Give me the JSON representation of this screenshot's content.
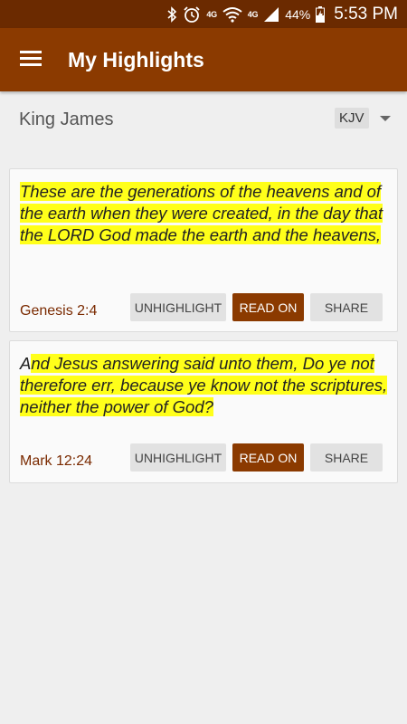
{
  "status_bar": {
    "battery_percent": "44%",
    "time": "5:53 PM",
    "network_label": "4G",
    "icons": [
      "bluetooth-icon",
      "alarm-icon",
      "wifi-icon",
      "signal-icon",
      "battery-icon"
    ]
  },
  "app_bar": {
    "title": "My Highlights",
    "menu_icon": "menu-icon",
    "color": "#8b3a00"
  },
  "translation": {
    "name": "King James",
    "version": "KJV"
  },
  "highlights": [
    {
      "text_before": "",
      "text_highlighted": "These are the generations of the heavens and of the earth when they were created, in the day that the LORD God made the earth and the heavens,",
      "reference": "Genesis 2:4",
      "buttons": {
        "unhighlight": "UNHIGHLIGHT",
        "read_on": "READ ON",
        "share": "SHARE"
      }
    },
    {
      "text_before": "A",
      "text_highlighted": "nd Jesus answering said unto them, Do ye not therefore err, because ye know not the scriptures, neither the power of God?",
      "reference": "Mark 12:24",
      "buttons": {
        "unhighlight": "UNHIGHLIGHT",
        "read_on": "READ ON",
        "share": "SHARE"
      }
    }
  ],
  "colors": {
    "highlight": "#ffff1a",
    "accent": "#8b3a00",
    "status_bar": "#6b2a00"
  }
}
